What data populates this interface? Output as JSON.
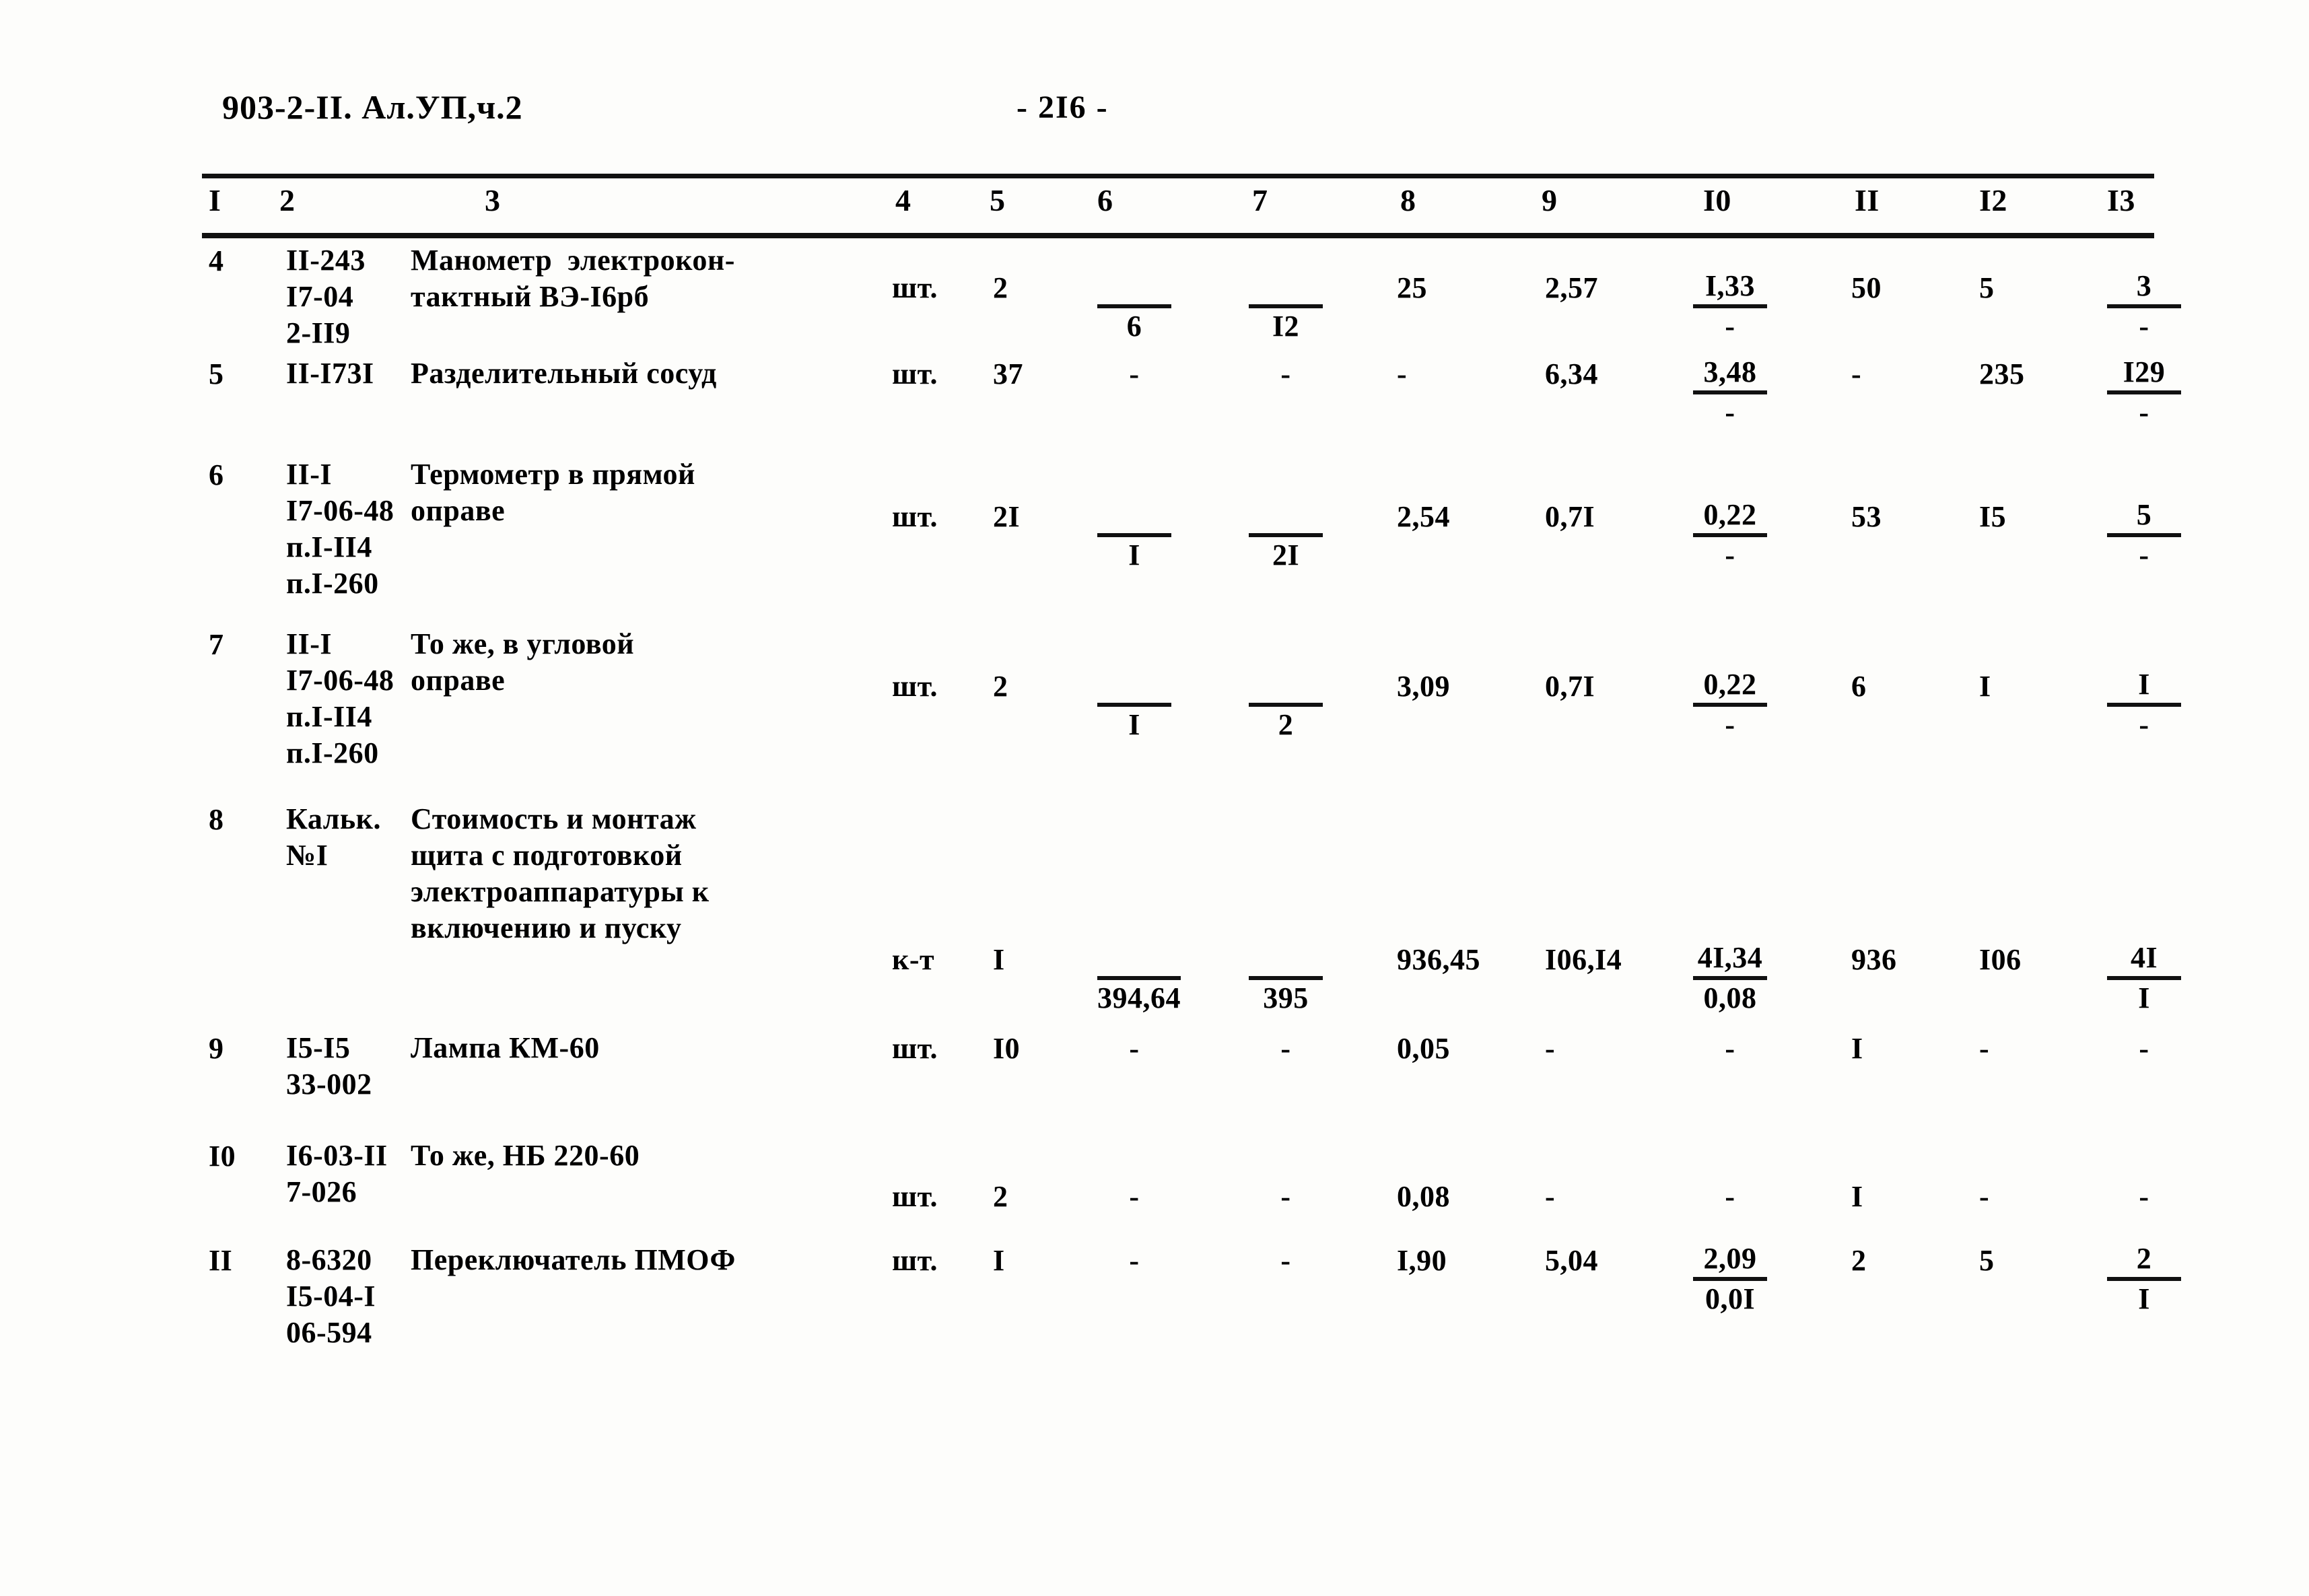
{
  "document": {
    "code": "903-2-II. Ал.УП,ч.2",
    "page_label": "- 2I6 -"
  },
  "table": {
    "column_headers": [
      "I",
      "2",
      "3",
      "4",
      "5",
      "6",
      "7",
      "8",
      "9",
      "I0",
      "II",
      "I2",
      "I3"
    ],
    "rows": [
      {
        "no": "4",
        "code": "II-243\nI7-04\n2-II9",
        "name": "Манометр  электрокон-\nтактный ВЭ-I6рб",
        "unit": "шт.",
        "qty": "2",
        "c6_num": "",
        "c6_den": "6",
        "c7_num": "",
        "c7_den": "I2",
        "c8": "25",
        "c9": "2,57",
        "c10_num": "I,33",
        "c10_den": "-",
        "c11": "50",
        "c12": "5",
        "c13_num": "3",
        "c13_den": "-"
      },
      {
        "no": "5",
        "code": "II-I73I",
        "name": "Разделительный сосуд",
        "unit": "шт.",
        "qty": "37",
        "c6_num": "-",
        "c6_den": "",
        "c7_num": "-",
        "c7_den": "",
        "c8": "-",
        "c9": "6,34",
        "c10_num": "3,48",
        "c10_den": "-",
        "c11": "-",
        "c12": "235",
        "c13_num": "I29",
        "c13_den": "-"
      },
      {
        "no": "6",
        "code": "II-I\nI7-06-48\nп.I-II4\nп.I-260",
        "name": "Термометр в прямой\nоправе",
        "unit": "шт.",
        "qty": "2I",
        "c6_num": "",
        "c6_den": "I",
        "c7_num": "",
        "c7_den": "2I",
        "c8": "2,54",
        "c9": "0,7I",
        "c10_num": "0,22",
        "c10_den": "-",
        "c11": "53",
        "c12": "I5",
        "c13_num": "5",
        "c13_den": "-"
      },
      {
        "no": "7",
        "code": "II-I\nI7-06-48\nп.I-II4\nп.I-260",
        "name": "То же, в угловой\nоправе",
        "unit": "шт.",
        "qty": "2",
        "c6_num": "",
        "c6_den": "I",
        "c7_num": "",
        "c7_den": "2",
        "c8": "3,09",
        "c9": "0,7I",
        "c10_num": "0,22",
        "c10_den": "-",
        "c11": "6",
        "c12": "I",
        "c13_num": "I",
        "c13_den": "-"
      },
      {
        "no": "8",
        "code": "Кальк.\n№I",
        "name": "Стоимость и монтаж\nщита с подготовкой\nэлектроаппаратуры к\nвключению и пуску",
        "unit": "к-т",
        "qty": "I",
        "c6_num": "",
        "c6_den": "394,64",
        "c7_num": "",
        "c7_den": "395",
        "c8": "936,45",
        "c9": "I06,I4",
        "c10_num": "4I,34",
        "c10_den": "0,08",
        "c11": "936",
        "c12": "I06",
        "c13_num": "4I",
        "c13_den": "I"
      },
      {
        "no": "9",
        "code": "I5-I5\n33-002",
        "name": "Лампа КМ-60",
        "unit": "шт.",
        "qty": "I0",
        "c6_num": "-",
        "c6_den": "",
        "c7_num": "-",
        "c7_den": "",
        "c8": "0,05",
        "c9": "-",
        "c10_num": "-",
        "c10_den": "",
        "c11": "I",
        "c12": "-",
        "c13_num": "-",
        "c13_den": ""
      },
      {
        "no": "I0",
        "code": "I6-03-II\n7-026",
        "name": "То же, НБ 220-60",
        "unit": "шт.",
        "qty": "2",
        "c6_num": "-",
        "c6_den": "",
        "c7_num": "-",
        "c7_den": "",
        "c8": "0,08",
        "c9": "-",
        "c10_num": "-",
        "c10_den": "",
        "c11": "I",
        "c12": "-",
        "c13_num": "-",
        "c13_den": ""
      },
      {
        "no": "II",
        "code": "8-6320\nI5-04-I\n06-594",
        "name": "Переключатель ПМОФ",
        "unit": "шт.",
        "qty": "I",
        "c6_num": "-",
        "c6_den": "",
        "c7_num": "-",
        "c7_den": "",
        "c8": "I,90",
        "c9": "5,04",
        "c10_num": "2,09",
        "c10_den": "0,0I",
        "c11": "2",
        "c12": "5",
        "c13_num": "2",
        "c13_den": "I"
      }
    ]
  }
}
